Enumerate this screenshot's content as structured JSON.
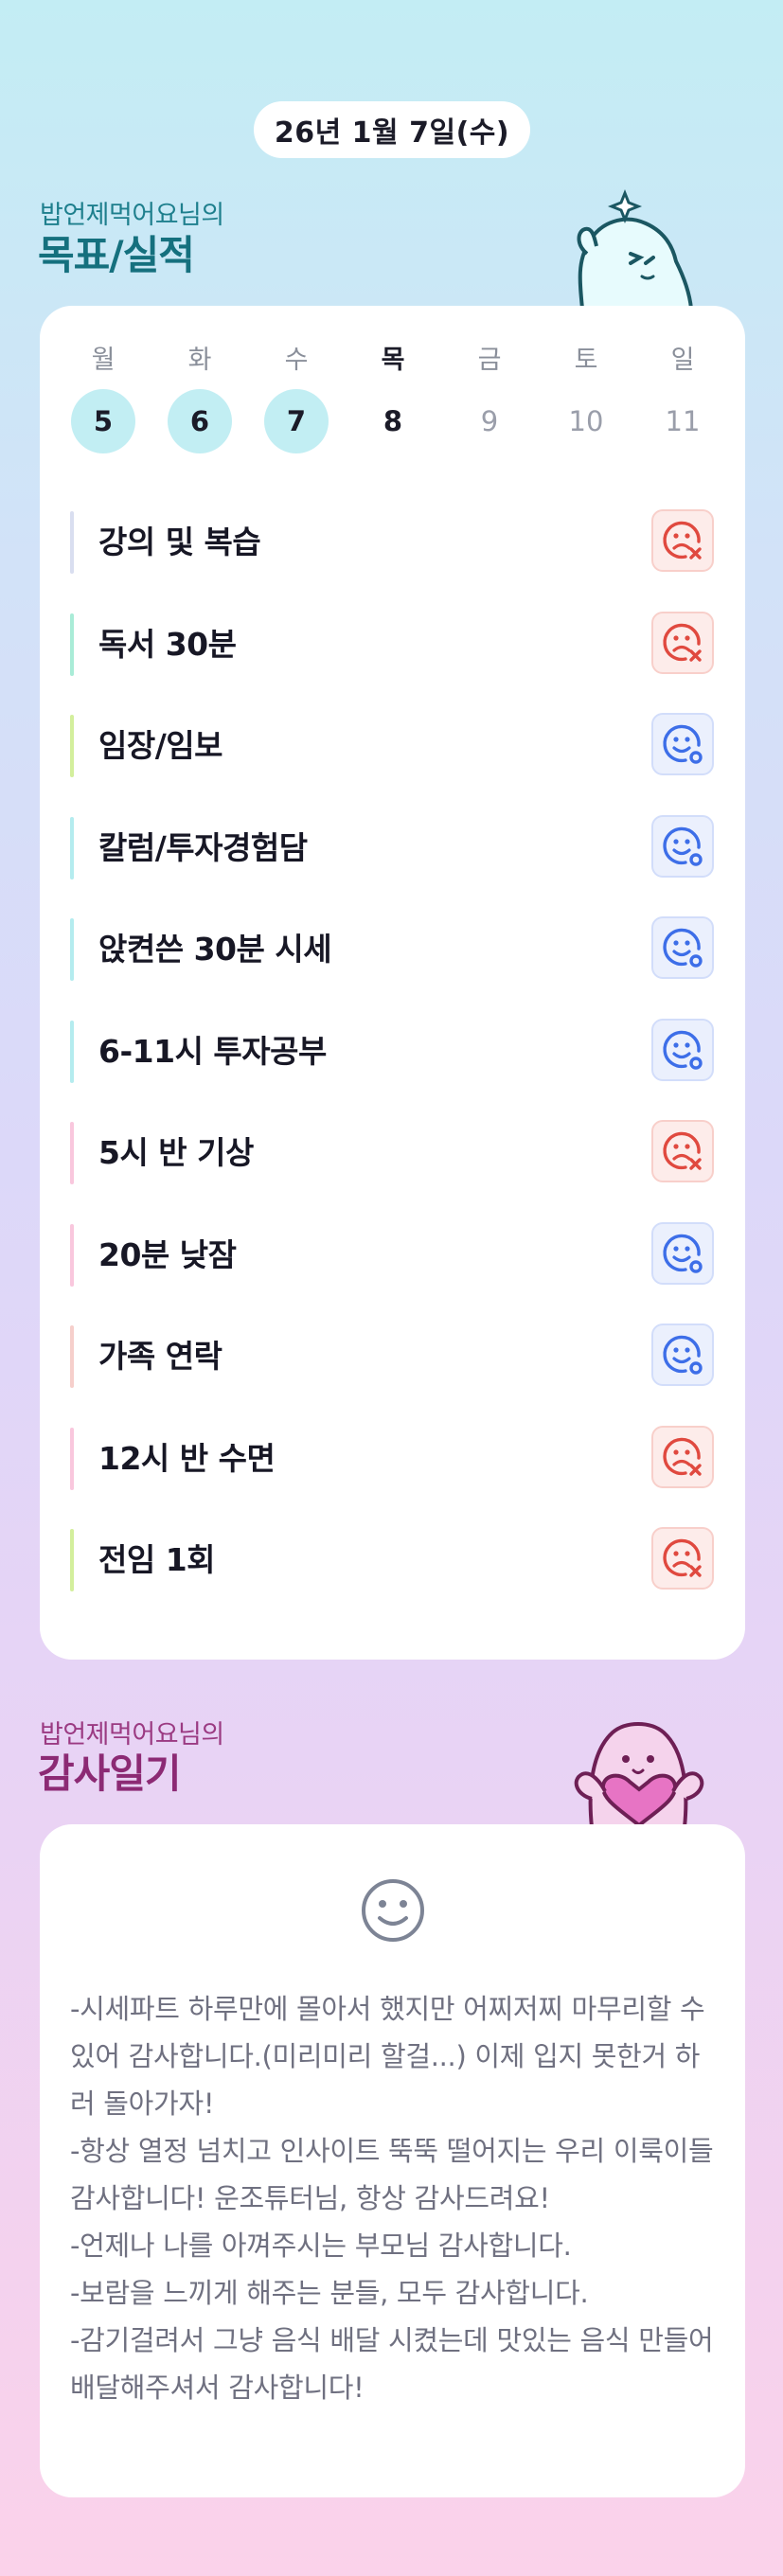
{
  "header": {
    "date": "26년 1월 7일(수)"
  },
  "goals_section": {
    "subtitle": "밥언제먹어요님의",
    "title": "목표/실적"
  },
  "week": [
    {
      "weekday": "월",
      "day": "5",
      "state": "done"
    },
    {
      "weekday": "화",
      "day": "6",
      "state": "done"
    },
    {
      "weekday": "수",
      "day": "7",
      "state": "done"
    },
    {
      "weekday": "목",
      "day": "8",
      "state": "today"
    },
    {
      "weekday": "금",
      "day": "9",
      "state": "future"
    },
    {
      "weekday": "토",
      "day": "10",
      "state": "future"
    },
    {
      "weekday": "일",
      "day": "11",
      "state": "future"
    }
  ],
  "goals": [
    {
      "label": "강의 및 복습",
      "status": "fail",
      "color": "#d9def0",
      "icon": "sad-face-x-icon"
    },
    {
      "label": "독서 30분",
      "status": "fail",
      "color": "#a9ecd7",
      "icon": "sad-face-x-icon"
    },
    {
      "label": "임장/임보",
      "status": "ok",
      "color": "#d3ef9c",
      "icon": "smile-face-o-icon"
    },
    {
      "label": "칼럼/투자경험담",
      "status": "ok",
      "color": "#b4ecef",
      "icon": "smile-face-o-icon"
    },
    {
      "label": "앉켠쓴 30분 시세",
      "status": "ok",
      "color": "#b4ecef",
      "icon": "smile-face-o-icon"
    },
    {
      "label": "6-11시 투자공부",
      "status": "ok",
      "color": "#b4ecef",
      "icon": "smile-face-o-icon"
    },
    {
      "label": "5시 반 기상",
      "status": "fail",
      "color": "#f9c7dd",
      "icon": "sad-face-x-icon"
    },
    {
      "label": "20분 낮잠",
      "status": "ok",
      "color": "#f9c7dd",
      "icon": "smile-face-o-icon"
    },
    {
      "label": "가족 연락",
      "status": "ok",
      "color": "#f6cfcb",
      "icon": "smile-face-o-icon"
    },
    {
      "label": "12시 반 수면",
      "status": "fail",
      "color": "#f9c7dd",
      "icon": "sad-face-x-icon"
    },
    {
      "label": "전임 1회",
      "status": "fail",
      "color": "#d3ef9c",
      "icon": "sad-face-x-icon"
    }
  ],
  "gratitude_section": {
    "subtitle": "밥언제먹어요님의",
    "title": "감사일기",
    "mood_icon": "smile-face-icon",
    "text": "-시세파트 하루만에 몰아서 했지만 어찌저찌 마무리할 수 있어 감사합니다.(미리미리 할걸...) 이제 입지 못한거 하러 돌아가자!\n-항상 열정 넘치고 인사이트 뚝뚝 떨어지는 우리 이룩이들 감사합니다! 운조튜터님, 항상 감사드려요!\n-언제나 나를 아껴주시는 부모님 감사합니다.\n-보람을 느끼게 해주는 분들, 모두 감사합니다.\n-감기걸려서 그냥 음식 배달 시켰는데 맛있는 음식 만들어 배달해주셔서 감사합니다!"
  },
  "colors": {
    "fail": "#e0493f",
    "ok": "#3d6ee8",
    "done_day": "#c2eef3"
  }
}
